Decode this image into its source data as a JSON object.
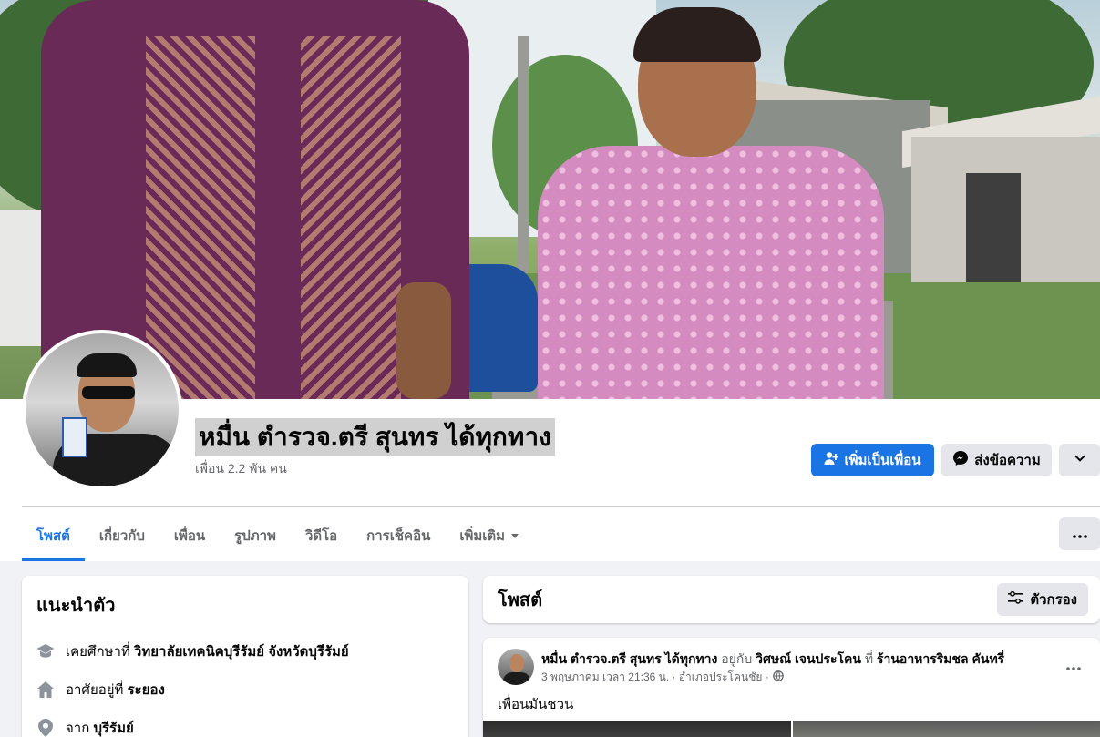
{
  "profile": {
    "name": "หมื่น ตำรวจ.ตรี สุนทร ได้ทุกทาง",
    "friends_count": "เพื่อน 2.2 พัน คน"
  },
  "actions": {
    "add_friend": "เพิ่มเป็นเพื่อน",
    "message": "ส่งข้อความ"
  },
  "tabs": [
    {
      "label": "โพสต์",
      "active": true
    },
    {
      "label": "เกี่ยวกับ"
    },
    {
      "label": "เพื่อน"
    },
    {
      "label": "รูปภาพ"
    },
    {
      "label": "วิดีโอ"
    },
    {
      "label": "การเช็คอิน"
    },
    {
      "label": "เพิ่มเติม"
    }
  ],
  "intro": {
    "title": "แนะนำตัว",
    "items": [
      {
        "icon": "graduation-cap-icon",
        "prefix": "เคยศึกษาที่ ",
        "value": "วิทยาลัยเทคนิคบุรีรัมย์ จังหวัดบุรีรัมย์"
      },
      {
        "icon": "home-icon",
        "prefix": "อาศัยอยู่ที่ ",
        "value": "ระยอง"
      },
      {
        "icon": "location-pin-icon",
        "prefix": "จาก ",
        "value": "บุรีรัมย์"
      }
    ]
  },
  "posts_section": {
    "title": "โพสต์",
    "filter_label": "ตัวกรอง"
  },
  "post": {
    "author": "หมื่น ตำรวจ.ตรี สุนทร ได้ทุกทาง",
    "with_text": " อยู่กับ ",
    "tagged": "วิศษณ์ เจนประโคน",
    "at_text": " ที่ ",
    "place": "ร้านอาหารริมชล คันทรี่",
    "meta": "3 พฤษภาคม เวลา 21:36 น. · อำเภอประโคนชัย ·",
    "text": "เพื่อนมันชวน"
  },
  "colors": {
    "accent": "#1b74e4",
    "background": "#f0f2f5"
  }
}
